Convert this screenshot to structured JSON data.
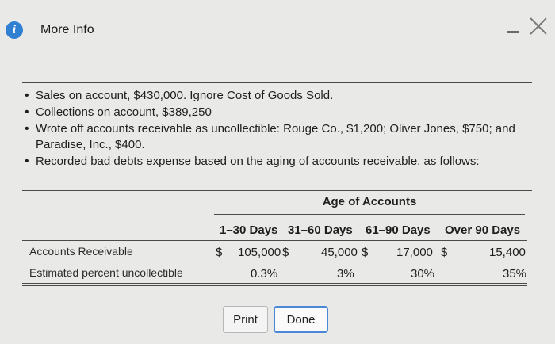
{
  "window": {
    "title": "More Info"
  },
  "bullets": [
    [
      "Sales on account, $430,000. Ignore Cost of Goods Sold."
    ],
    [
      "Collections on account, $389,250"
    ],
    [
      "Wrote off accounts receivable as uncollectible: Rouge Co., $1,200; Oliver Jones, $750; and",
      "Paradise, Inc., $400."
    ],
    [
      "Recorded bad debts expense based on the aging of accounts receivable, as follows:"
    ]
  ],
  "table": {
    "group_header": "Age of Accounts",
    "columns": [
      "1–30 Days",
      "31–60 Days",
      "61–90 Days",
      "Over 90 Days"
    ],
    "rows": [
      {
        "label": "Accounts Receivable",
        "currency": "$",
        "values": [
          "105,000",
          "45,000",
          "17,000",
          "15,400"
        ]
      },
      {
        "label": "Estimated percent uncollectible",
        "values": [
          "0.3%",
          "3%",
          "30%",
          "35%"
        ]
      }
    ]
  },
  "buttons": {
    "print": "Print",
    "done": "Done"
  }
}
